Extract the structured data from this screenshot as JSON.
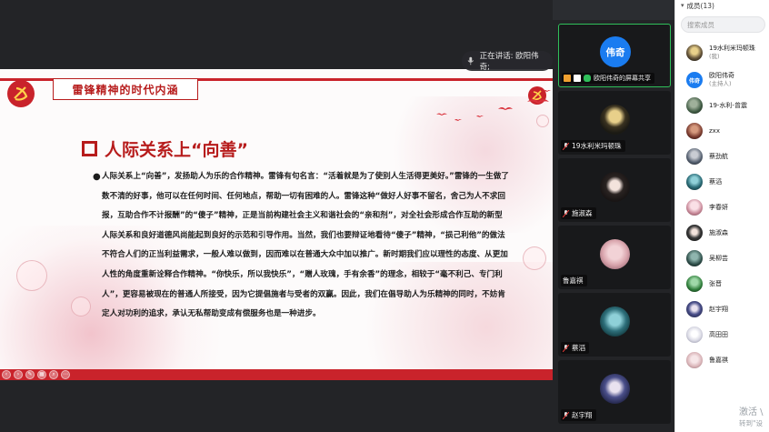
{
  "slide": {
    "header_title": "雷锋精神的时代内涵",
    "heading": "人际关系上“向善”",
    "bullet": "●",
    "body": "人际关系上“向善”，发扬助人为乐的合作精神。雷锋有句名言：“活着就是为了使别人生活得更美好。”雷锋的一生做了数不清的好事，他可以在任何时间、任何地点，帮助一切有困难的人。雷锋这种“做好人好事不留名，舍己为人不求回报，互助合作不计报酬”的“傻子”精神，正是当前构建社会主义和谐社会的“亲和剂”，对全社会形成合作互助的新型人际关系和良好道德风尚能起到良好的示范和引导作用。当然，我们也要辩证地看待“傻子”精神，“损己利他”的做法不符合人们的正当利益需求，一般人难以做到，因而难以在普通大众中加以推广。新时期我们应以理性的态度、从更加人性的角度重新诠释合作精神。“你快乐，所以我快乐”，“赠人玫瑰，手有余香”的理念，相较于“毫不利己、专门利人”，更容易被现在的普通人所接受，因为它提倡施者与受者的双赢。因此，我们在倡导助人为乐精神的同时，不妨肯定人对功利的追求，承认无私帮助变成有偿服务也是一种进步。"
  },
  "speaker_toast": {
    "text": "正在讲话: 欧阳伟奇;"
  },
  "video_tiles": [
    {
      "name": "欧阳伟奇的屏幕共享",
      "avatar_text": "伟奇",
      "active": true
    },
    {
      "name": "19水利米玛顿珠"
    },
    {
      "name": "施淑森"
    },
    {
      "name": "鲁嘉祺"
    },
    {
      "name": "蔡滔"
    },
    {
      "name": "赵宇翔"
    }
  ],
  "members": {
    "title": "成员(13)",
    "search_placeholder": "搜索成员",
    "items": [
      {
        "name": "19水利米玛顿珠",
        "sub": "(我)",
        "color": "#6b5a3e"
      },
      {
        "name": "欧阳伟奇",
        "sub": "(主持人)",
        "color": "#1a7cf0",
        "avatar_text": "伟奇"
      },
      {
        "name": "19-水利-曾震",
        "color": "#3f5a43"
      },
      {
        "name": "zxx",
        "color": "#7a3b2f"
      },
      {
        "name": "蔡劲航",
        "color": "#556070"
      },
      {
        "name": "蔡滔",
        "color": "#2e6f7a"
      },
      {
        "name": "李春妍",
        "color": "#c98a9a"
      },
      {
        "name": "施淑森",
        "color": "#3a3a3a"
      },
      {
        "name": "吴柳芸",
        "color": "#2f4f4a"
      },
      {
        "name": "张晋",
        "color": "#2f7d3a"
      },
      {
        "name": "赵宇翔",
        "color": "#4a4f8a"
      },
      {
        "name": "高田田",
        "color": "#dcdce6"
      },
      {
        "name": "鲁嘉祺",
        "color": "#d9b4b8"
      }
    ]
  },
  "watermark": {
    "line1": "激活 \\",
    "line2": "转到\"设"
  },
  "colors": {
    "accent_red": "#c9232b",
    "active_green": "#2fbf5a",
    "avatar_blue": "#1a7cf0"
  }
}
